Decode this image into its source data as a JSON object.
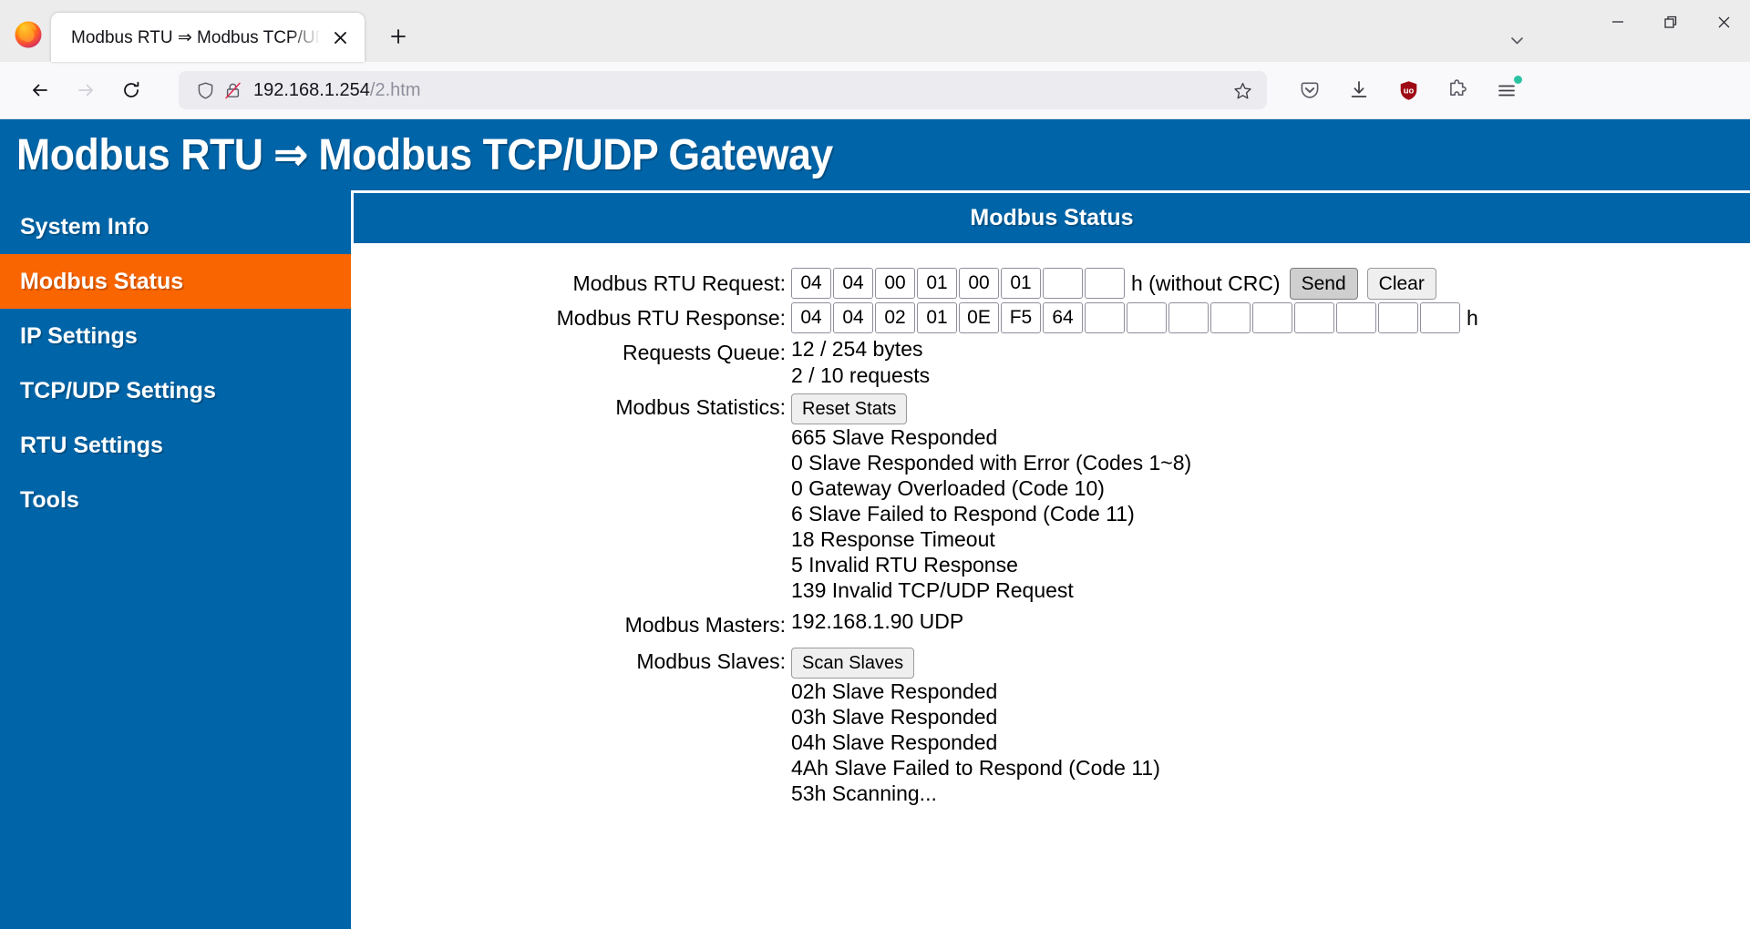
{
  "browser": {
    "tab": {
      "title": "Modbus RTU ⇒ Modbus TCP/UDP G",
      "close_label": "✕"
    },
    "newtab_label": "+",
    "window": {
      "list_tabs": "⌄",
      "minimize": "—",
      "restore": "❐",
      "close": "✕"
    },
    "nav": {
      "back": "←",
      "forward": "→",
      "reload": "⟳"
    },
    "url": {
      "host": "192.168.1.254",
      "path": "/2.htm"
    },
    "toolbar": {
      "pocket": "pocket-icon",
      "downloads": "download-icon",
      "ublock": "ublock-origin-icon",
      "ublock_label": "uo",
      "extensions": "extensions-puzzle-icon",
      "appmenu": "hamburger-menu-icon"
    }
  },
  "page": {
    "header_title": "Modbus RTU ⇒ Modbus TCP/UDP Gateway",
    "main_title": "Modbus Status",
    "accent_blue": "#0065a8",
    "accent_orange": "#f96500"
  },
  "sidebar": {
    "items": [
      {
        "label": "System Info",
        "active": false
      },
      {
        "label": "Modbus Status",
        "active": true
      },
      {
        "label": "IP Settings",
        "active": false
      },
      {
        "label": "TCP/UDP Settings",
        "active": false
      },
      {
        "label": "RTU Settings",
        "active": false
      },
      {
        "label": "Tools",
        "active": false
      }
    ]
  },
  "form": {
    "request": {
      "label": "Modbus RTU Request:",
      "bytes": [
        "04",
        "04",
        "00",
        "01",
        "00",
        "01",
        "",
        ""
      ],
      "suffix": "h (without CRC)",
      "send_label": "Send",
      "clear_label": "Clear"
    },
    "response": {
      "label": "Modbus RTU Response:",
      "bytes": [
        "04",
        "04",
        "02",
        "01",
        "0E",
        "F5",
        "64",
        "",
        "",
        "",
        "",
        "",
        "",
        "",
        "",
        ""
      ],
      "suffix": "h"
    },
    "queue": {
      "label": "Requests Queue:",
      "bytes_line": "12 / 254 bytes",
      "requests_line": "2 / 10 requests"
    },
    "statistics": {
      "label": "Modbus Statistics:",
      "reset_label": "Reset Stats",
      "lines": [
        "665 Slave Responded",
        "0 Slave Responded with Error (Codes 1~8)",
        "0 Gateway Overloaded (Code 10)",
        "6 Slave Failed to Respond (Code 11)",
        "18 Response Timeout",
        "5 Invalid RTU Response",
        "139 Invalid TCP/UDP Request"
      ]
    },
    "masters": {
      "label": "Modbus Masters:",
      "lines": [
        "192.168.1.90 UDP"
      ]
    },
    "slaves": {
      "label": "Modbus Slaves:",
      "scan_label": "Scan Slaves",
      "lines": [
        "02h Slave Responded",
        "03h Slave Responded",
        "04h Slave Responded",
        "4Ah Slave Failed to Respond (Code 11)",
        "53h Scanning..."
      ]
    }
  }
}
